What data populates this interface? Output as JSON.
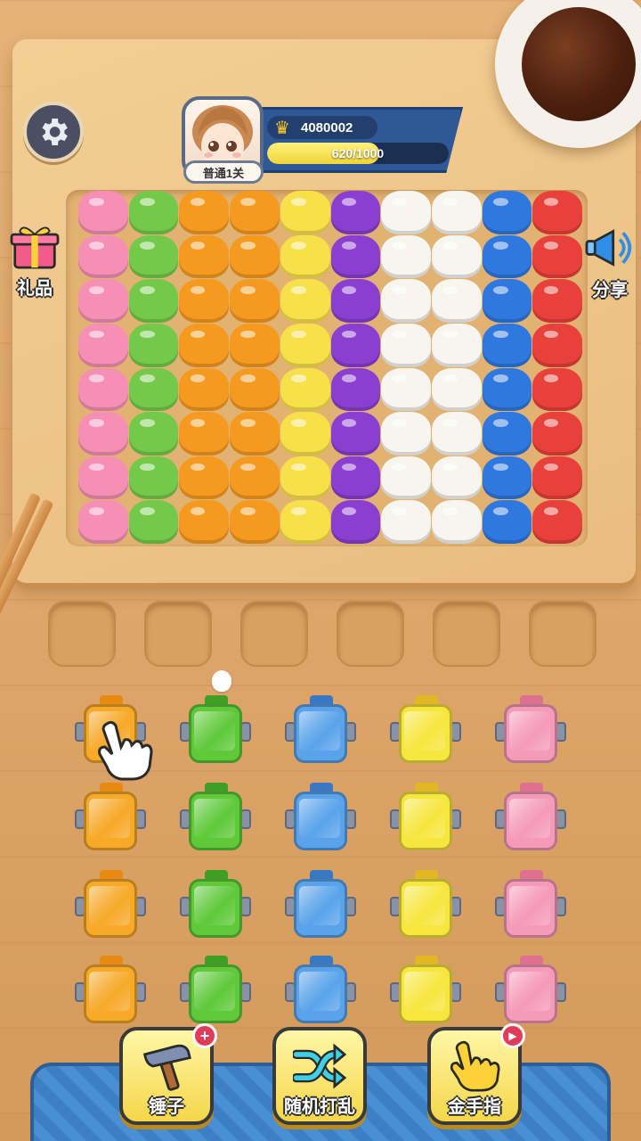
{
  "player": {
    "level_label": "普通1关",
    "score": "4080002",
    "progress_text": "620/1000",
    "progress_fraction": 0.62
  },
  "side": {
    "gift_label": "礼品",
    "share_label": "分享"
  },
  "food_columns": [
    {
      "name": "shrimp",
      "color": "#f58fb3"
    },
    {
      "name": "bok-choy",
      "color": "#74c94a"
    },
    {
      "name": "fried-shrimp",
      "color": "#f59a1f"
    },
    {
      "name": "fried-shrimp",
      "color": "#f59a1f"
    },
    {
      "name": "tamago",
      "color": "#f7e04a"
    },
    {
      "name": "eggplant",
      "color": "#8a3fd1"
    },
    {
      "name": "rice-ball",
      "color": "#f7f5ee"
    },
    {
      "name": "rice-ball",
      "color": "#f7f5ee"
    },
    {
      "name": "fish",
      "color": "#2f78e0"
    },
    {
      "name": "tuna",
      "color": "#e8403a"
    }
  ],
  "container_colors": [
    {
      "name": "orange",
      "color": "#f7a928",
      "lid": "#e88a12"
    },
    {
      "name": "green",
      "color": "#5fc93a",
      "lid": "#3f9e24"
    },
    {
      "name": "blue",
      "color": "#5aa3ea",
      "lid": "#3a78c4"
    },
    {
      "name": "yellow",
      "color": "#f7e63e",
      "lid": "#e0b824"
    },
    {
      "name": "pink",
      "color": "#f59ab8",
      "lid": "#e0708f"
    }
  ],
  "tools": {
    "hammer_label": "锤子",
    "shuffle_label": "随机打乱",
    "golden_finger_label": "金手指",
    "hammer_badge": "+"
  }
}
